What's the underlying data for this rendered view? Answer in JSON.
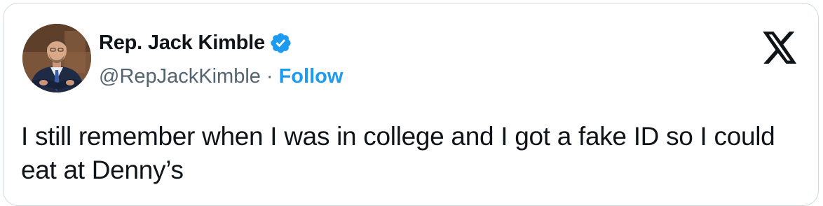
{
  "author": {
    "display_name": "Rep. Jack Kimble",
    "handle": "@RepJackKimble",
    "separator": "·",
    "follow_label": "Follow",
    "verified_icon": "verified-badge-icon",
    "avatar": "avatar"
  },
  "tweet": {
    "text": "I still remember when I was in college and I got a fake ID so I could eat at Denny’s"
  },
  "brand": {
    "logo_icon": "x-logo-icon"
  },
  "colors": {
    "text_primary": "#0f1419",
    "text_secondary": "#536471",
    "accent": "#1d9bf0",
    "border": "#cfd9de"
  }
}
